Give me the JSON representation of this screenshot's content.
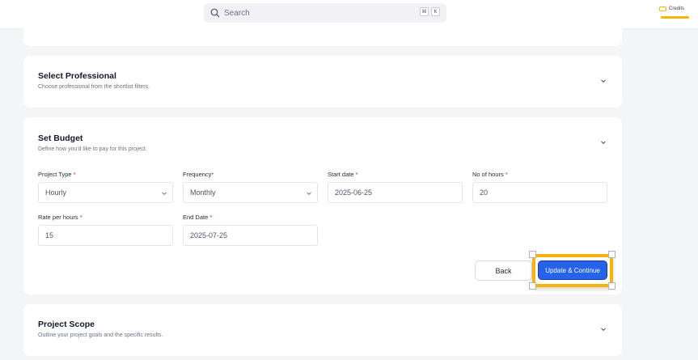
{
  "header": {
    "search_placeholder": "Search",
    "shortcut_keys": [
      "⌘",
      "K"
    ],
    "credits_label": "Credits"
  },
  "sections": {
    "select_professional": {
      "title": "Select Professional",
      "subtitle": "Choose professional from the shortlist filters."
    },
    "set_budget": {
      "title": "Set Budget",
      "subtitle": "Define how you'd like to pay for this project.",
      "fields": {
        "project_type": {
          "label": "Project Type",
          "required_mark": "*",
          "value": "Hourly"
        },
        "frequency": {
          "label": "Frequency",
          "required_mark": "*",
          "value": "Monthly"
        },
        "start_date": {
          "label": "Start date",
          "required_mark": "*",
          "value": "2025-06-25"
        },
        "no_of_hours": {
          "label": "No of hours",
          "required_mark": "*",
          "value": "20"
        },
        "rate_per_hours": {
          "label": "Rate per hours",
          "required_mark": "*",
          "value": "15"
        },
        "end_date": {
          "label": "End Date",
          "required_mark": "*",
          "value": "2025-07-25"
        }
      },
      "back_label": "Back",
      "update_label": "Update & Continue"
    },
    "project_scope": {
      "title": "Project Scope",
      "subtitle": "Outline your project goals and the specific results."
    }
  },
  "colors": {
    "accent": "#2563eb",
    "highlight": "#f5b30b",
    "required": "#e11d48",
    "background": "#f4f5f7"
  }
}
